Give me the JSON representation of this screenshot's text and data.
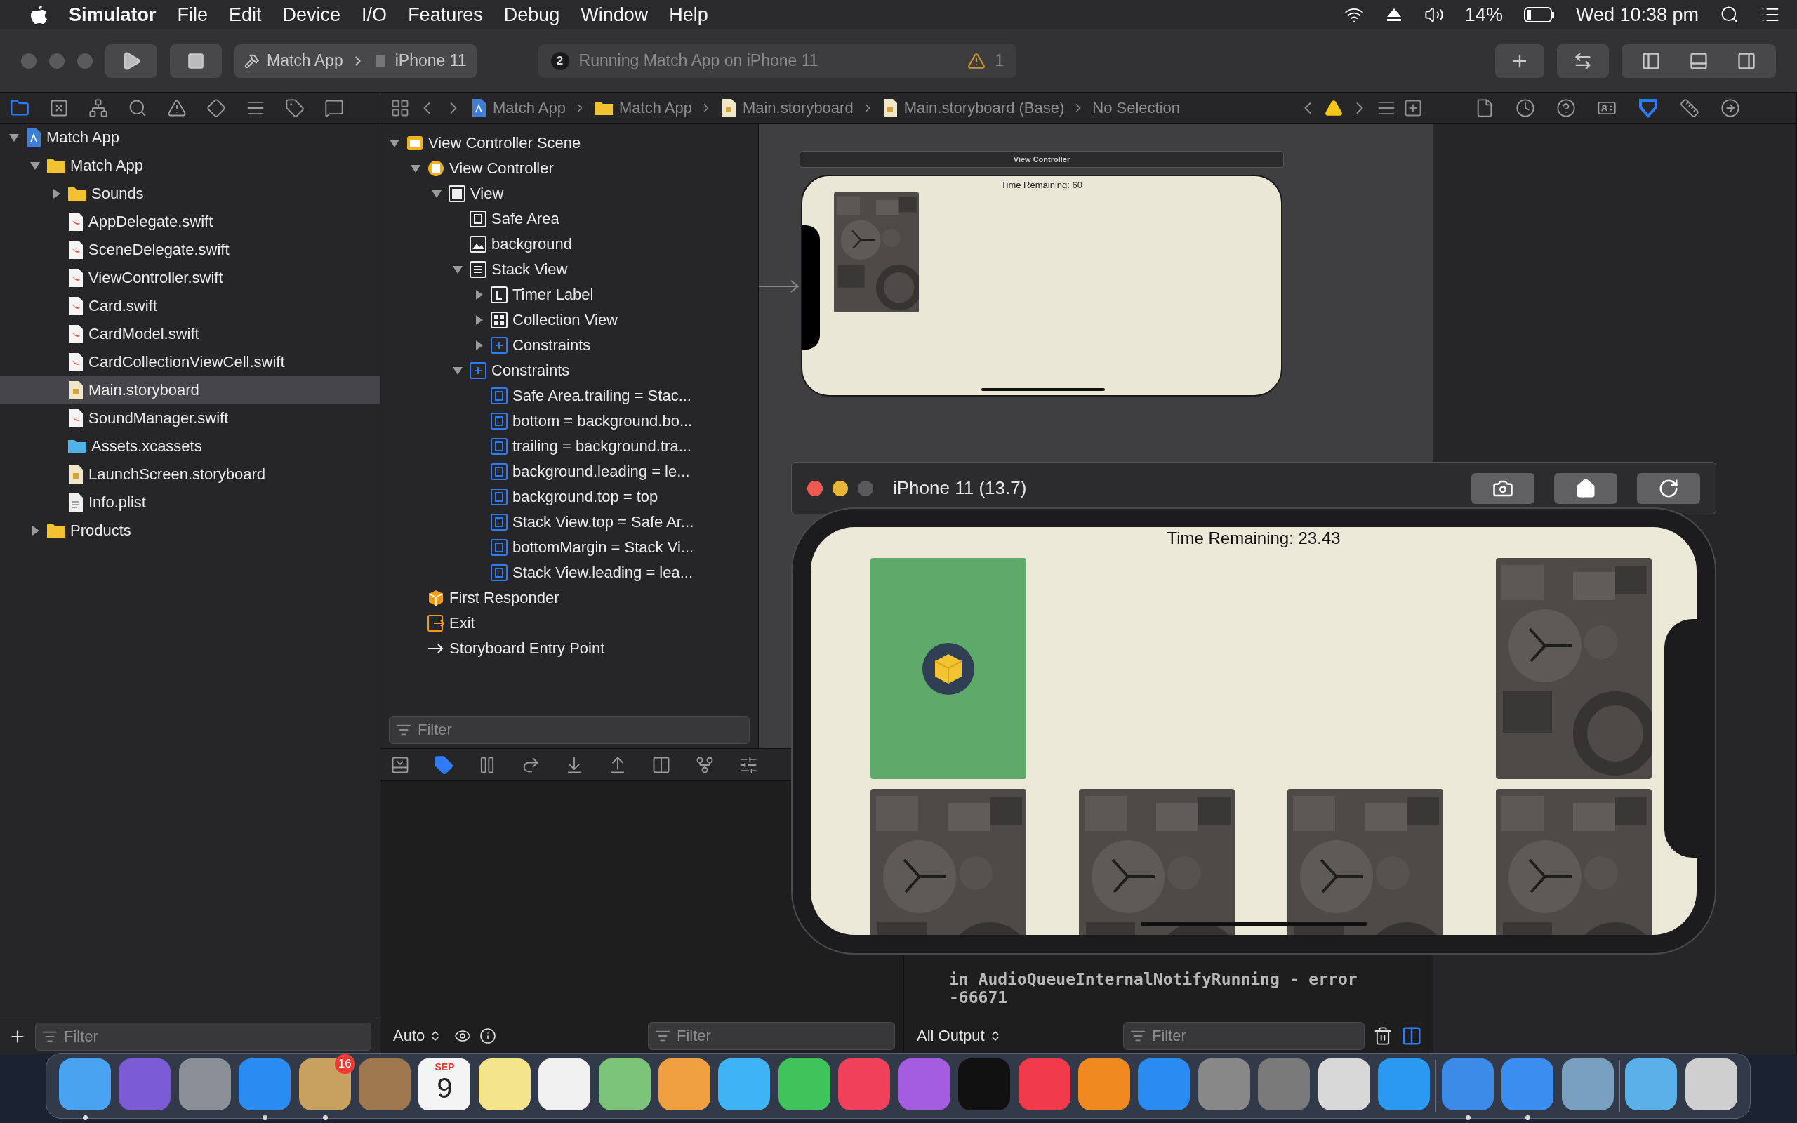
{
  "menubar": {
    "app": "Simulator",
    "menus": [
      "File",
      "Edit",
      "Device",
      "I/O",
      "Features",
      "Debug",
      "Window",
      "Help"
    ],
    "battery": "14%",
    "clock": "Wed 10:38 pm"
  },
  "toolbar": {
    "scheme": "Match App",
    "device": "iPhone 11",
    "activity_count": "2",
    "activity": "Running Match App on iPhone 11",
    "warnings": "1"
  },
  "navigator": {
    "tree": [
      {
        "label": "Match App",
        "kind": "project",
        "expanded": true,
        "selected": false,
        "children": [
          {
            "label": "Match App",
            "kind": "folder",
            "expanded": true,
            "selected": false,
            "children": [
              {
                "label": "Sounds",
                "kind": "folder",
                "expanded": false,
                "selected": false
              },
              {
                "label": "AppDelegate.swift",
                "kind": "swift",
                "selected": false
              },
              {
                "label": "SceneDelegate.swift",
                "kind": "swift",
                "selected": false
              },
              {
                "label": "ViewController.swift",
                "kind": "swift",
                "selected": false
              },
              {
                "label": "Card.swift",
                "kind": "swift",
                "selected": false
              },
              {
                "label": "CardModel.swift",
                "kind": "swift",
                "selected": false
              },
              {
                "label": "CardCollectionViewCell.swift",
                "kind": "swift",
                "selected": false
              },
              {
                "label": "Main.storyboard",
                "kind": "storyboard",
                "selected": true
              },
              {
                "label": "SoundManager.swift",
                "kind": "swift",
                "selected": false
              },
              {
                "label": "Assets.xcassets",
                "kind": "assets",
                "selected": false
              },
              {
                "label": "LaunchScreen.storyboard",
                "kind": "storyboard",
                "selected": false
              },
              {
                "label": "Info.plist",
                "kind": "plist",
                "selected": false
              }
            ]
          },
          {
            "label": "Products",
            "kind": "folder",
            "expanded": false,
            "selected": false
          }
        ]
      }
    ],
    "filter": {
      "placeholder": "Filter"
    }
  },
  "jump_bar": [
    {
      "label": "Match App",
      "kind": "project"
    },
    {
      "label": "Match App",
      "kind": "folder"
    },
    {
      "label": "Main.storyboard",
      "kind": "storyboard"
    },
    {
      "label": "Main.storyboard (Base)",
      "kind": "storyboard"
    },
    {
      "label": "No Selection",
      "kind": "none"
    }
  ],
  "outline": {
    "tree": [
      {
        "label": "View Controller Scene",
        "kind": "scene",
        "expanded": true,
        "children": [
          {
            "label": "View Controller",
            "kind": "vc",
            "expanded": true,
            "children": [
              {
                "label": "View",
                "kind": "view",
                "expanded": true,
                "children": [
                  {
                    "label": "Safe Area",
                    "kind": "safearea"
                  },
                  {
                    "label": "background",
                    "kind": "image"
                  },
                  {
                    "label": "Stack View",
                    "kind": "stack",
                    "expanded": true,
                    "children": [
                      {
                        "label": "Timer Label",
                        "kind": "label",
                        "expanded": false
                      },
                      {
                        "label": "Collection View",
                        "kind": "collection",
                        "expanded": false
                      },
                      {
                        "label": "Constraints",
                        "kind": "constraints",
                        "expanded": false
                      }
                    ]
                  },
                  {
                    "label": "Constraints",
                    "kind": "constraints",
                    "expanded": true,
                    "children": [
                      {
                        "label": "Safe Area.trailing = Stac...",
                        "kind": "constraint"
                      },
                      {
                        "label": "bottom = background.bo...",
                        "kind": "constraint"
                      },
                      {
                        "label": "trailing = background.tra...",
                        "kind": "constraint"
                      },
                      {
                        "label": "background.leading = le...",
                        "kind": "constraint"
                      },
                      {
                        "label": "background.top = top",
                        "kind": "constraint"
                      },
                      {
                        "label": "Stack View.top = Safe Ar...",
                        "kind": "constraint"
                      },
                      {
                        "label": "bottomMargin = Stack Vi...",
                        "kind": "constraint"
                      },
                      {
                        "label": "Stack View.leading = lea...",
                        "kind": "constraint"
                      }
                    ]
                  }
                ]
              }
            ]
          },
          {
            "label": "First Responder",
            "kind": "responder"
          },
          {
            "label": "Exit",
            "kind": "exit"
          },
          {
            "label": "Storyboard Entry Point",
            "kind": "entry"
          }
        ]
      }
    ],
    "filter": {
      "placeholder": "Filter"
    }
  },
  "canvas": {
    "scene_title": "View Controller",
    "timer": "Time Remaining: 60"
  },
  "debug": {
    "scope": "Auto",
    "variables_filter": {
      "placeholder": "Filter"
    },
    "output": "All Output",
    "console_filter": {
      "placeholder": "Filter"
    },
    "console_lines": [
      "in AudioQueueInternalNotifyRunning - error",
      "-66671"
    ]
  },
  "simulator": {
    "title": "iPhone 11 (13.7)",
    "timer": "Time Remaining: 23.43",
    "cards": [
      {
        "face_up": true,
        "matched": false
      },
      {
        "matched": true
      },
      {
        "matched": true
      },
      {
        "face_up": false,
        "matched": false
      },
      {
        "face_up": false,
        "matched": false
      },
      {
        "face_up": false,
        "matched": false
      },
      {
        "face_up": false,
        "matched": false
      },
      {
        "face_up": false,
        "matched": false
      }
    ]
  },
  "dock": {
    "items": [
      {
        "kind": "app",
        "color": "#4aa3f0",
        "running": true
      },
      {
        "kind": "app",
        "color": "#7b5cd6",
        "running": false
      },
      {
        "kind": "app",
        "color": "#8a8f98",
        "running": false
      },
      {
        "kind": "app",
        "color": "#2a8cf0",
        "running": true
      },
      {
        "kind": "app",
        "color": "#c8a060",
        "running": true,
        "badge": "16"
      },
      {
        "kind": "app",
        "color": "#a07850",
        "running": false
      },
      {
        "kind": "calendar",
        "color": "#f4f4f4",
        "running": false,
        "month": "SEP",
        "day": "9"
      },
      {
        "kind": "app",
        "color": "#f5e58a",
        "running": false
      },
      {
        "kind": "app",
        "color": "#f0f0f0",
        "running": false
      },
      {
        "kind": "app",
        "color": "#7cc47a",
        "running": false
      },
      {
        "kind": "app",
        "color": "#f0a040",
        "running": false
      },
      {
        "kind": "app",
        "color": "#3fb4f5",
        "running": false
      },
      {
        "kind": "app",
        "color": "#3ec45a",
        "running": false
      },
      {
        "kind": "app",
        "color": "#f0405a",
        "running": false
      },
      {
        "kind": "app",
        "color": "#a45ce0",
        "running": false
      },
      {
        "kind": "app",
        "color": "#111111",
        "running": false
      },
      {
        "kind": "app",
        "color": "#f03a4a",
        "running": false
      },
      {
        "kind": "app",
        "color": "#f08a20",
        "running": false
      },
      {
        "kind": "app",
        "color": "#2a8cf0",
        "running": false
      },
      {
        "kind": "app",
        "color": "#888888",
        "running": false
      },
      {
        "kind": "app",
        "color": "#7a7a7a",
        "running": false
      },
      {
        "kind": "app",
        "color": "#d8d8d8",
        "running": false
      },
      {
        "kind": "app",
        "color": "#2a9af0",
        "running": false
      },
      {
        "kind": "separator"
      },
      {
        "kind": "app",
        "color": "#3d8be8",
        "running": true
      },
      {
        "kind": "app",
        "color": "#3b8ef0",
        "running": true
      },
      {
        "kind": "app",
        "color": "#7aa0c0",
        "running": false
      },
      {
        "kind": "separator"
      },
      {
        "kind": "app",
        "color": "#5ab0e8",
        "running": false
      },
      {
        "kind": "app",
        "color": "#cfcfcf",
        "running": false
      }
    ]
  }
}
